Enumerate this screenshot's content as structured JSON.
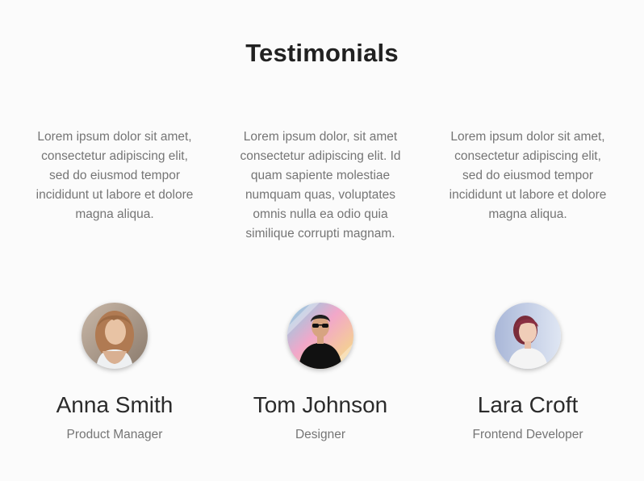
{
  "section": {
    "title": "Testimonials"
  },
  "testimonials": [
    {
      "quote": "Lorem ipsum dolor sit amet, consectetur adipiscing elit, sed do eiusmod tempor incididunt ut labore et dolore magna aliqua.",
      "name": "Anna Smith",
      "role": "Product Manager",
      "avatar_icon": "woman-portrait-icon"
    },
    {
      "quote": "Lorem ipsum dolor, sit amet consectetur adipiscing elit. Id quam sapiente molestiae numquam quas, voluptates omnis nulla ea odio quia similique corrupti magnam.",
      "name": "Tom Johnson",
      "role": "Designer",
      "avatar_icon": "man-portrait-icon"
    },
    {
      "quote": "Lorem ipsum dolor sit amet, consectetur adipiscing elit, sed do eiusmod tempor incididunt ut labore et dolore magna aliqua.",
      "name": "Lara Croft",
      "role": "Frontend Developer",
      "avatar_icon": "woman-portrait-icon"
    }
  ]
}
